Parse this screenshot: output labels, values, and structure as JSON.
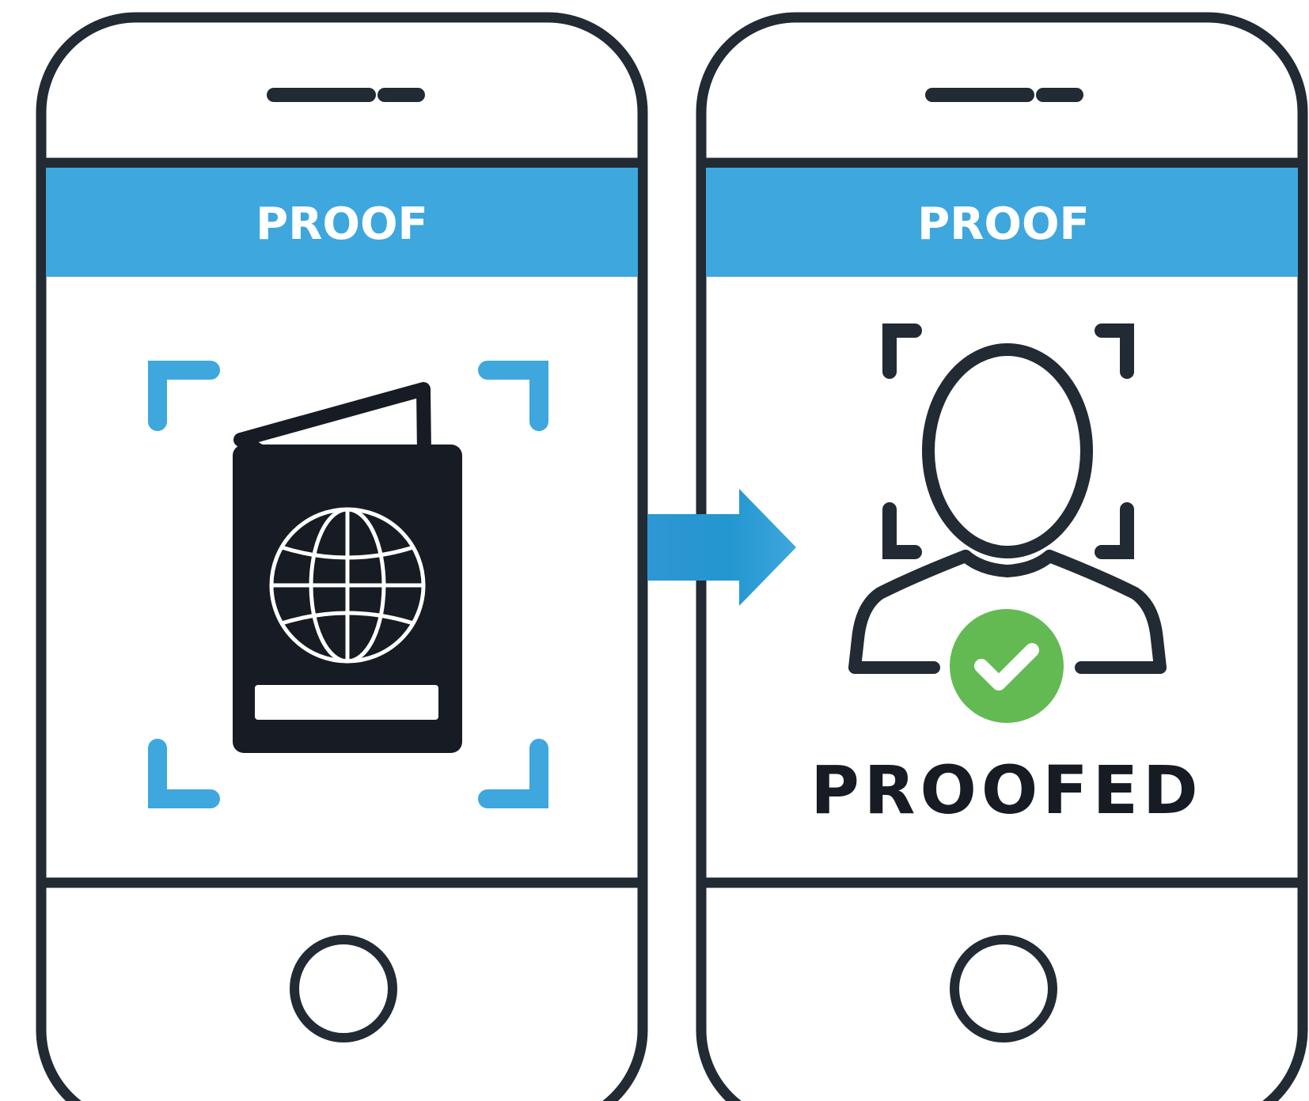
{
  "colors": {
    "outline": "#222a33",
    "accent_blue": "#3ea7dd",
    "passport_fill": "#171b23",
    "check_green": "#63ba53",
    "background": "#ffffff"
  },
  "left_phone": {
    "header_label": "PROOF",
    "content_icon": "passport-icon",
    "frame_icon": "scan-frame-icon"
  },
  "arrow_icon": "arrow-right-icon",
  "right_phone": {
    "header_label": "PROOF",
    "content_icon": "person-icon",
    "frame_icon": "scan-frame-icon",
    "status_icon": "checkmark-icon",
    "status_label": "PROOFED"
  }
}
